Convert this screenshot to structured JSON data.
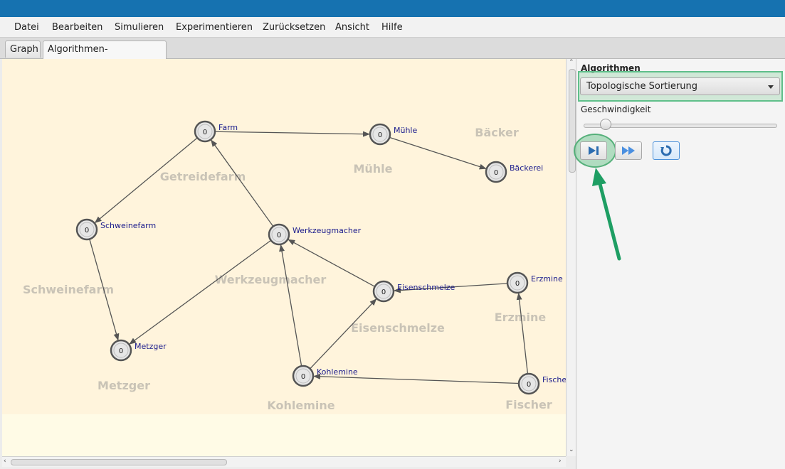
{
  "menu": [
    "Datei",
    "Bearbeiten",
    "Simulieren",
    "Experimentieren",
    "Zurücksetzen",
    "Ansicht",
    "Hilfe"
  ],
  "tabs": [
    {
      "label": "Graph"
    },
    {
      "label": "Algorithmen-Simulation",
      "close": "✕"
    }
  ],
  "graph": {
    "nodes": [
      {
        "id": "farm",
        "label": "Farm",
        "value": "0"
      },
      {
        "id": "muehle",
        "label": "Mühle",
        "value": "0"
      },
      {
        "id": "baeckerei",
        "label": "Bäckerei",
        "value": "0"
      },
      {
        "id": "schweinefarm",
        "label": "Schweinefarm",
        "value": "0"
      },
      {
        "id": "werkzeugmacher",
        "label": "Werkzeugmacher",
        "value": "0"
      },
      {
        "id": "eisenschmelze",
        "label": "Eisenschmelze",
        "value": "0"
      },
      {
        "id": "erzmine",
        "label": "Erzmine",
        "value": "0"
      },
      {
        "id": "metzger",
        "label": "Metzger",
        "value": "0"
      },
      {
        "id": "kohlemine",
        "label": "Kohlemine",
        "value": "0"
      },
      {
        "id": "fischer",
        "label": "Fischer",
        "value": "0"
      }
    ],
    "edges": [
      {
        "from": "farm",
        "to": "muehle"
      },
      {
        "from": "muehle",
        "to": "baeckerei"
      },
      {
        "from": "farm",
        "to": "schweinefarm"
      },
      {
        "from": "schweinefarm",
        "to": "metzger"
      },
      {
        "from": "werkzeugmacher",
        "to": "farm"
      },
      {
        "from": "werkzeugmacher",
        "to": "metzger"
      },
      {
        "from": "eisenschmelze",
        "to": "werkzeugmacher"
      },
      {
        "from": "erzmine",
        "to": "eisenschmelze"
      },
      {
        "from": "kohlemine",
        "to": "eisenschmelze"
      },
      {
        "from": "kohlemine",
        "to": "werkzeugmacher"
      },
      {
        "from": "fischer",
        "to": "kohlemine"
      },
      {
        "from": "fischer",
        "to": "erzmine"
      }
    ],
    "background_labels": [
      "Getreidefarm",
      "Mühle",
      "Bäcker",
      "Schweinefarm",
      "Werkzeugmacher",
      "Eisenschmelze",
      "Erzmine",
      "Metzger",
      "Kohlemine",
      "Fischer"
    ]
  },
  "side": {
    "algorithms_label": "Algorithmen",
    "algorithm_selected": "Topologische Sortierung",
    "speed_label": "Geschwindigkeit",
    "speed_level": 0.09
  },
  "colors": {
    "titlebar": "#1672b0",
    "highlight": "#5fbf8a",
    "annotation_arrow": "#1e9e63",
    "node_label": "#1a1a8c",
    "canvas_bg": "#fffbe6"
  }
}
